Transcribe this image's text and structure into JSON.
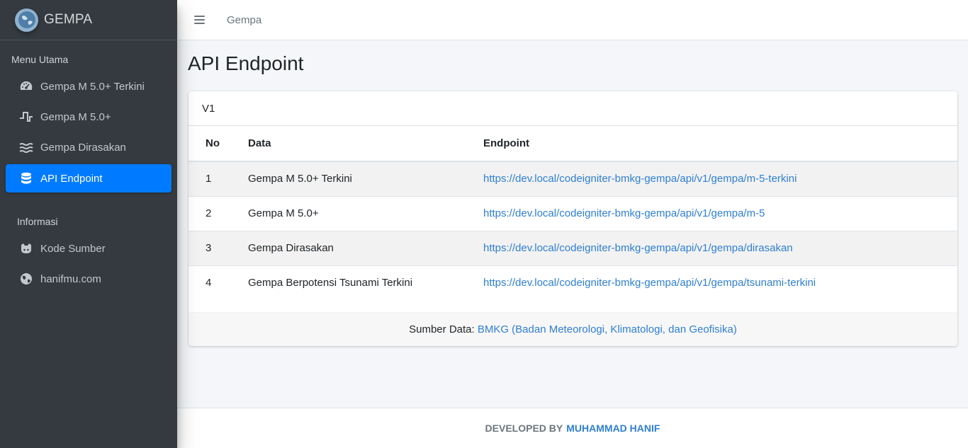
{
  "brand": {
    "name": "GEMPA"
  },
  "sidebar": {
    "header_main": "Menu Utama",
    "header_info": "Informasi",
    "items": [
      {
        "label": "Gempa M 5.0+ Terkini",
        "icon": "tachometer-icon"
      },
      {
        "label": "Gempa M 5.0+",
        "icon": "wave-square-icon"
      },
      {
        "label": "Gempa Dirasakan",
        "icon": "water-icon"
      },
      {
        "label": "API Endpoint",
        "icon": "database-icon",
        "active": true
      }
    ],
    "info_items": [
      {
        "label": "Kode Sumber",
        "icon": "github-icon"
      },
      {
        "label": "hanifmu.com",
        "icon": "globe-icon"
      }
    ]
  },
  "topbar": {
    "link": "Gempa"
  },
  "page": {
    "title": "API Endpoint"
  },
  "card": {
    "header": "V1",
    "columns": [
      "No",
      "Data",
      "Endpoint"
    ],
    "rows": [
      {
        "no": "1",
        "data": "Gempa M 5.0+ Terkini",
        "endpoint": "https://dev.local/codeigniter-bmkg-gempa/api/v1/gempa/m-5-terkini"
      },
      {
        "no": "2",
        "data": "Gempa M 5.0+",
        "endpoint": "https://dev.local/codeigniter-bmkg-gempa/api/v1/gempa/m-5"
      },
      {
        "no": "3",
        "data": "Gempa Dirasakan",
        "endpoint": "https://dev.local/codeigniter-bmkg-gempa/api/v1/gempa/dirasakan"
      },
      {
        "no": "4",
        "data": "Gempa Berpotensi Tsunami Terkini",
        "endpoint": "https://dev.local/codeigniter-bmkg-gempa/api/v1/gempa/tsunami-terkini"
      }
    ],
    "footer_label": "Sumber Data:",
    "footer_link": "BMKG (Badan Meteorologi, Klimatologi, dan Geofisika)"
  },
  "footer": {
    "prefix": "DEVELOPED BY",
    "author": "MUHAMMAD HANIF"
  },
  "colors": {
    "sidebar_bg": "#343a40",
    "accent": "#007bff",
    "link": "#2f7fd3"
  }
}
